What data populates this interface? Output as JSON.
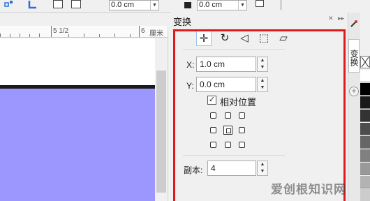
{
  "propbar": {
    "field_1": "0.0 cm",
    "field_2": "0.0 cm"
  },
  "ruler": {
    "label_1": "5 1/2",
    "label_2": "6",
    "unit": "厘米"
  },
  "panel": {
    "title": "变换",
    "modes": [
      {
        "icon": "position-icon",
        "glyph": "✛"
      },
      {
        "icon": "rotate-icon",
        "glyph": "↻"
      },
      {
        "icon": "mirror-icon",
        "glyph": "◁"
      },
      {
        "icon": "scale-icon",
        "glyph": "⬚"
      },
      {
        "icon": "skew-icon",
        "glyph": "▱"
      }
    ],
    "x_label": "X:",
    "x_value": "1.0 cm",
    "y_label": "Y:",
    "y_value": "0.0 cm",
    "relative_label": "相对位置",
    "relative_checked": "✓",
    "copies_label": "副本:",
    "copies_value": "4"
  },
  "side_tab_label": "变换",
  "palette_colors": [
    "#ffffff",
    "#000000",
    "#1a1a1a",
    "#333333",
    "#4d4d4d",
    "#666666",
    "#808080",
    "#999999",
    "#b3b3b3",
    "#cccccc"
  ],
  "watermark": "爱创根知识网"
}
